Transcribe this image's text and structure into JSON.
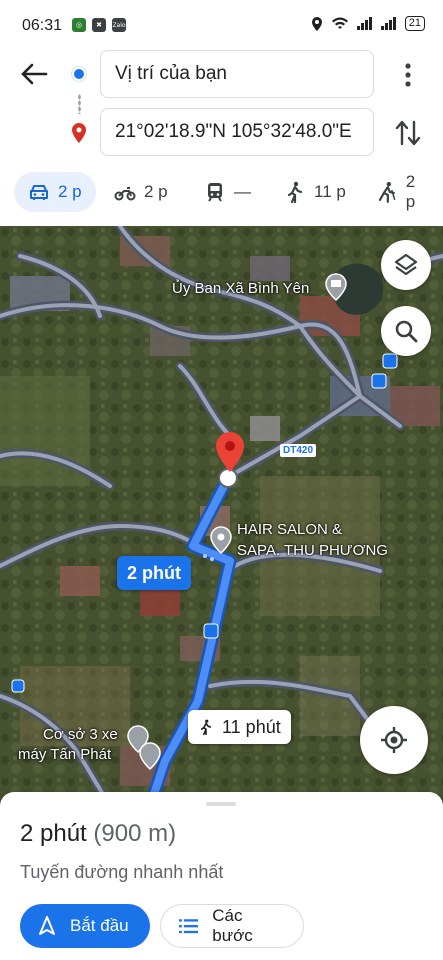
{
  "status_bar": {
    "time": "06:31",
    "battery": "21",
    "app_icons": [
      "Zalo"
    ]
  },
  "header": {
    "origin_value": "Vị trí của bạn",
    "destination_value": "21°02'18.9\"N 105°32'48.0\"E"
  },
  "modes": [
    {
      "icon": "car-icon",
      "label": "2 p",
      "active": true
    },
    {
      "icon": "motorbike-icon",
      "label": "2 p"
    },
    {
      "icon": "transit-icon",
      "label": "—"
    },
    {
      "icon": "walk-icon",
      "label": "11 p"
    },
    {
      "icon": "ride-icon",
      "label": "2 p"
    }
  ],
  "map": {
    "poi_ubnd": "Ủy Ban Xã Bình Yên",
    "road_badge": "DT420",
    "salon_line1": "HAIR SALON &",
    "salon_line2": "SAPA. THU PHƯƠNG",
    "drive_callout": "2 phút",
    "walk_callout": "11 phút",
    "shop_line1": "Cơ sở 3 xe",
    "shop_line2": "máy Tấn Phát",
    "colors": {
      "route": "#1a73e8",
      "pin": "#ea4335"
    }
  },
  "sheet": {
    "time": "2 phút",
    "distance": "(900 m)",
    "subtitle": "Tuyến đường nhanh nhất",
    "start_label": "Bắt đầu",
    "steps_label": "Các bước"
  }
}
